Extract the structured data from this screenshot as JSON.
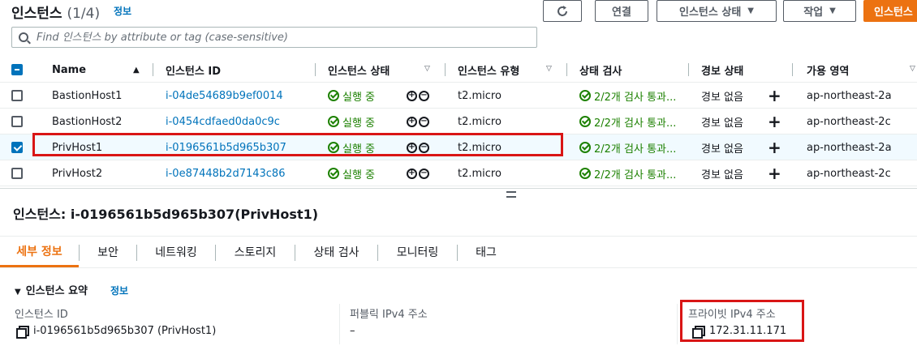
{
  "header": {
    "title": "인스턴스",
    "count": "(1/4)",
    "info_link": "정보",
    "buttons": {
      "refresh_icon": "refresh-icon",
      "connect": "연결",
      "instance_state": "인스턴스 상태",
      "actions": "작업",
      "launch": "인스턴스"
    }
  },
  "search": {
    "placeholder": "Find 인스턴스 by attribute or tag (case-sensitive)"
  },
  "table": {
    "columns": [
      "Name",
      "인스턴스 ID",
      "인스턴스 상태",
      "인스턴스 유형",
      "상태 검사",
      "경보 상태",
      "가용 영역"
    ],
    "rows": [
      {
        "name": "BastionHost1",
        "id": "i-04de54689b9ef0014",
        "state": "실행 중",
        "type": "t2.micro",
        "check": "2/2개 검사 통과...",
        "alarm": "경보 없음",
        "az": "ap-northeast-2a",
        "selected": false
      },
      {
        "name": "BastionHost2",
        "id": "i-0454cdfaed0da0c9c",
        "state": "실행 중",
        "type": "t2.micro",
        "check": "2/2개 검사 통과...",
        "alarm": "경보 없음",
        "az": "ap-northeast-2c",
        "selected": false
      },
      {
        "name": "PrivHost1",
        "id": "i-0196561b5d965b307",
        "state": "실행 중",
        "type": "t2.micro",
        "check": "2/2개 검사 통과...",
        "alarm": "경보 없음",
        "az": "ap-northeast-2a",
        "selected": true
      },
      {
        "name": "PrivHost2",
        "id": "i-0e87448b2d7143c86",
        "state": "실행 중",
        "type": "t2.micro",
        "check": "2/2개 검사 통과...",
        "alarm": "경보 없음",
        "az": "ap-northeast-2c",
        "selected": false
      }
    ]
  },
  "detail": {
    "title": "인스턴스: i-0196561b5d965b307(PrivHost1)",
    "tabs": [
      "세부 정보",
      "보안",
      "네트워킹",
      "스토리지",
      "상태 검사",
      "모니터링",
      "태그"
    ],
    "active_tab": "세부 정보",
    "section_title": "인스턴스 요약",
    "section_info": "정보",
    "fields": {
      "instance_id_label": "인스턴스 ID",
      "instance_id_value": "i-0196561b5d965b307 (PrivHost1)",
      "public_ip_label": "퍼블릭 IPv4 주소",
      "public_ip_value": "–",
      "private_ip_label": "프라이빗 IPv4 주소",
      "private_ip_value": "172.31.11.171"
    }
  },
  "colors": {
    "accent": "#ec7211",
    "link": "#0073bb",
    "success": "#1d8102",
    "highlight": "#d91515"
  }
}
